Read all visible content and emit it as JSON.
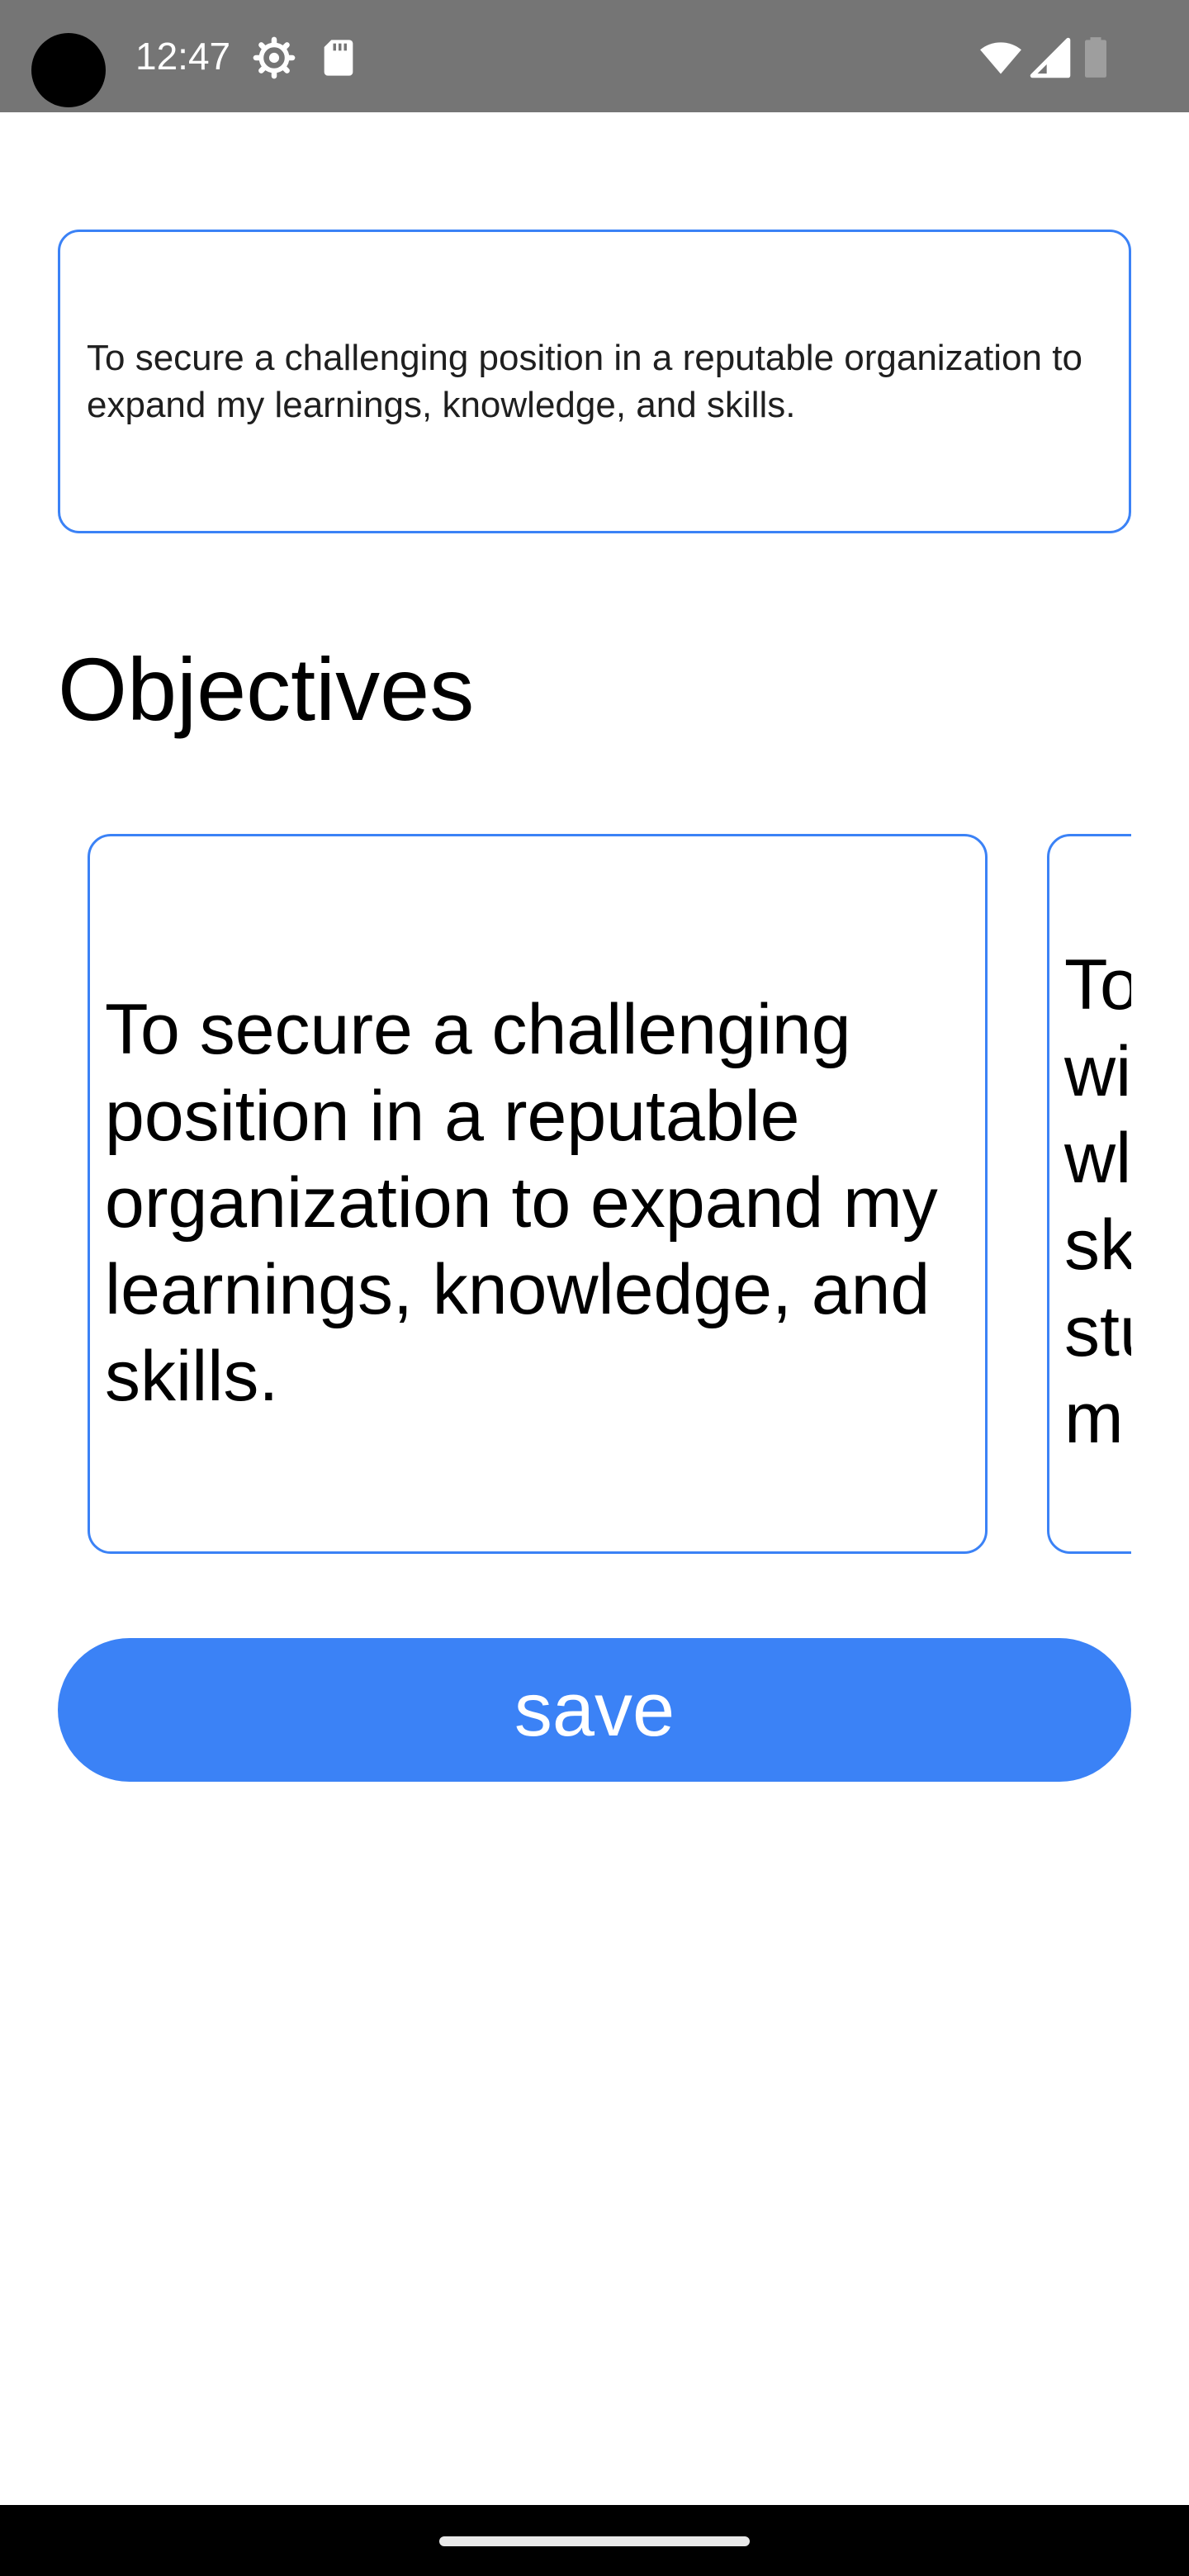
{
  "status_bar": {
    "time": "12:47",
    "icons": [
      "settings-gear-icon",
      "sd-card-icon",
      "wifi-icon",
      "cell-signal-icon",
      "battery-icon"
    ]
  },
  "summary_box": {
    "text": "To secure a challenging position in a reputable organization to expand my learnings, knowledge, and skills."
  },
  "objectives": {
    "heading": "Objectives",
    "cards": [
      {
        "text": "To secure a challenging position in a reputable organization to expand my learnings, knowledge, and skills."
      },
      {
        "text": "To\nwi\nwl\nsk\nstu\nm"
      }
    ]
  },
  "save_button": {
    "label": "save"
  },
  "colors": {
    "accent": "#3b82f6",
    "status_bar": "#757575",
    "nav_bar": "#000000"
  }
}
